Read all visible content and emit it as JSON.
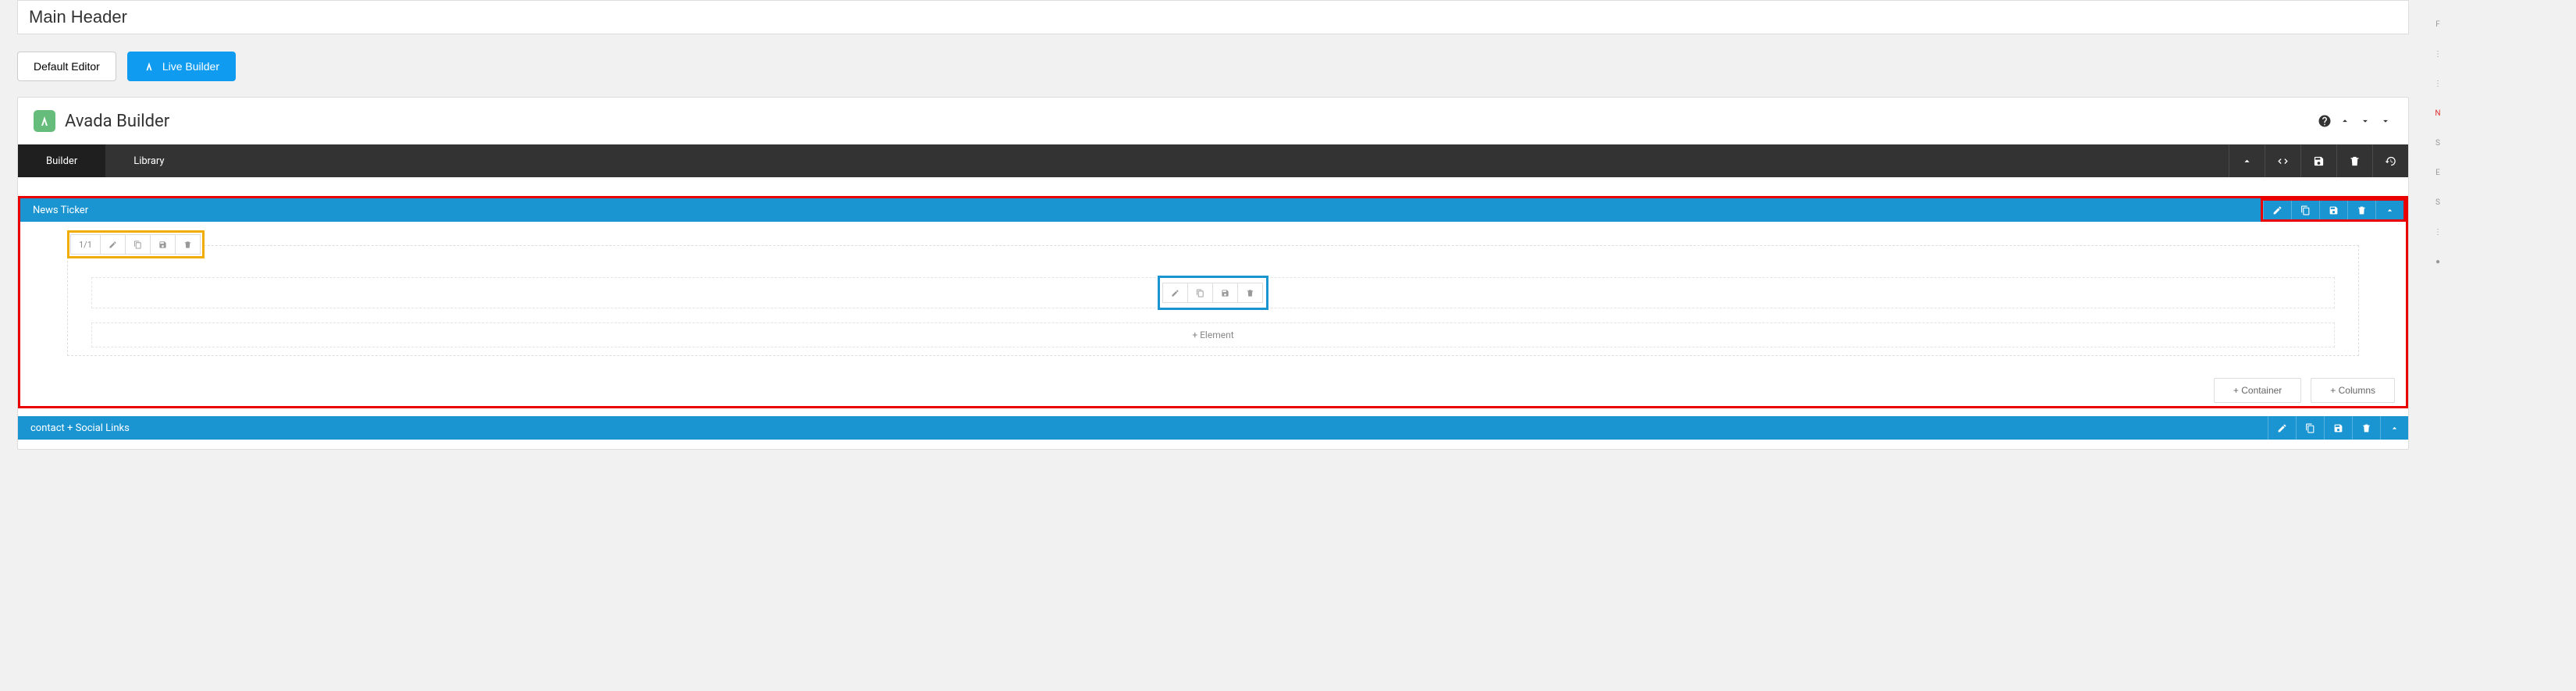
{
  "title_input": "Main Header",
  "buttons": {
    "default_editor": "Default Editor",
    "live_builder": "Live Builder"
  },
  "builder": {
    "brand": "Avada Builder",
    "tabs": {
      "builder": "Builder",
      "library": "Library"
    }
  },
  "containers": [
    {
      "name": "News Ticker"
    },
    {
      "name": "contact + Social Links"
    }
  ],
  "column": {
    "size": "1/1"
  },
  "actions": {
    "add_element": "+ Element",
    "add_container": "+ Container",
    "add_columns": "+ Columns"
  },
  "icons": {
    "edit": "edit",
    "clone": "clone",
    "save": "save",
    "delete": "delete",
    "collapse": "collapse",
    "help": "help",
    "code": "code",
    "history": "history",
    "up": "up",
    "down": "down",
    "more": "more"
  }
}
